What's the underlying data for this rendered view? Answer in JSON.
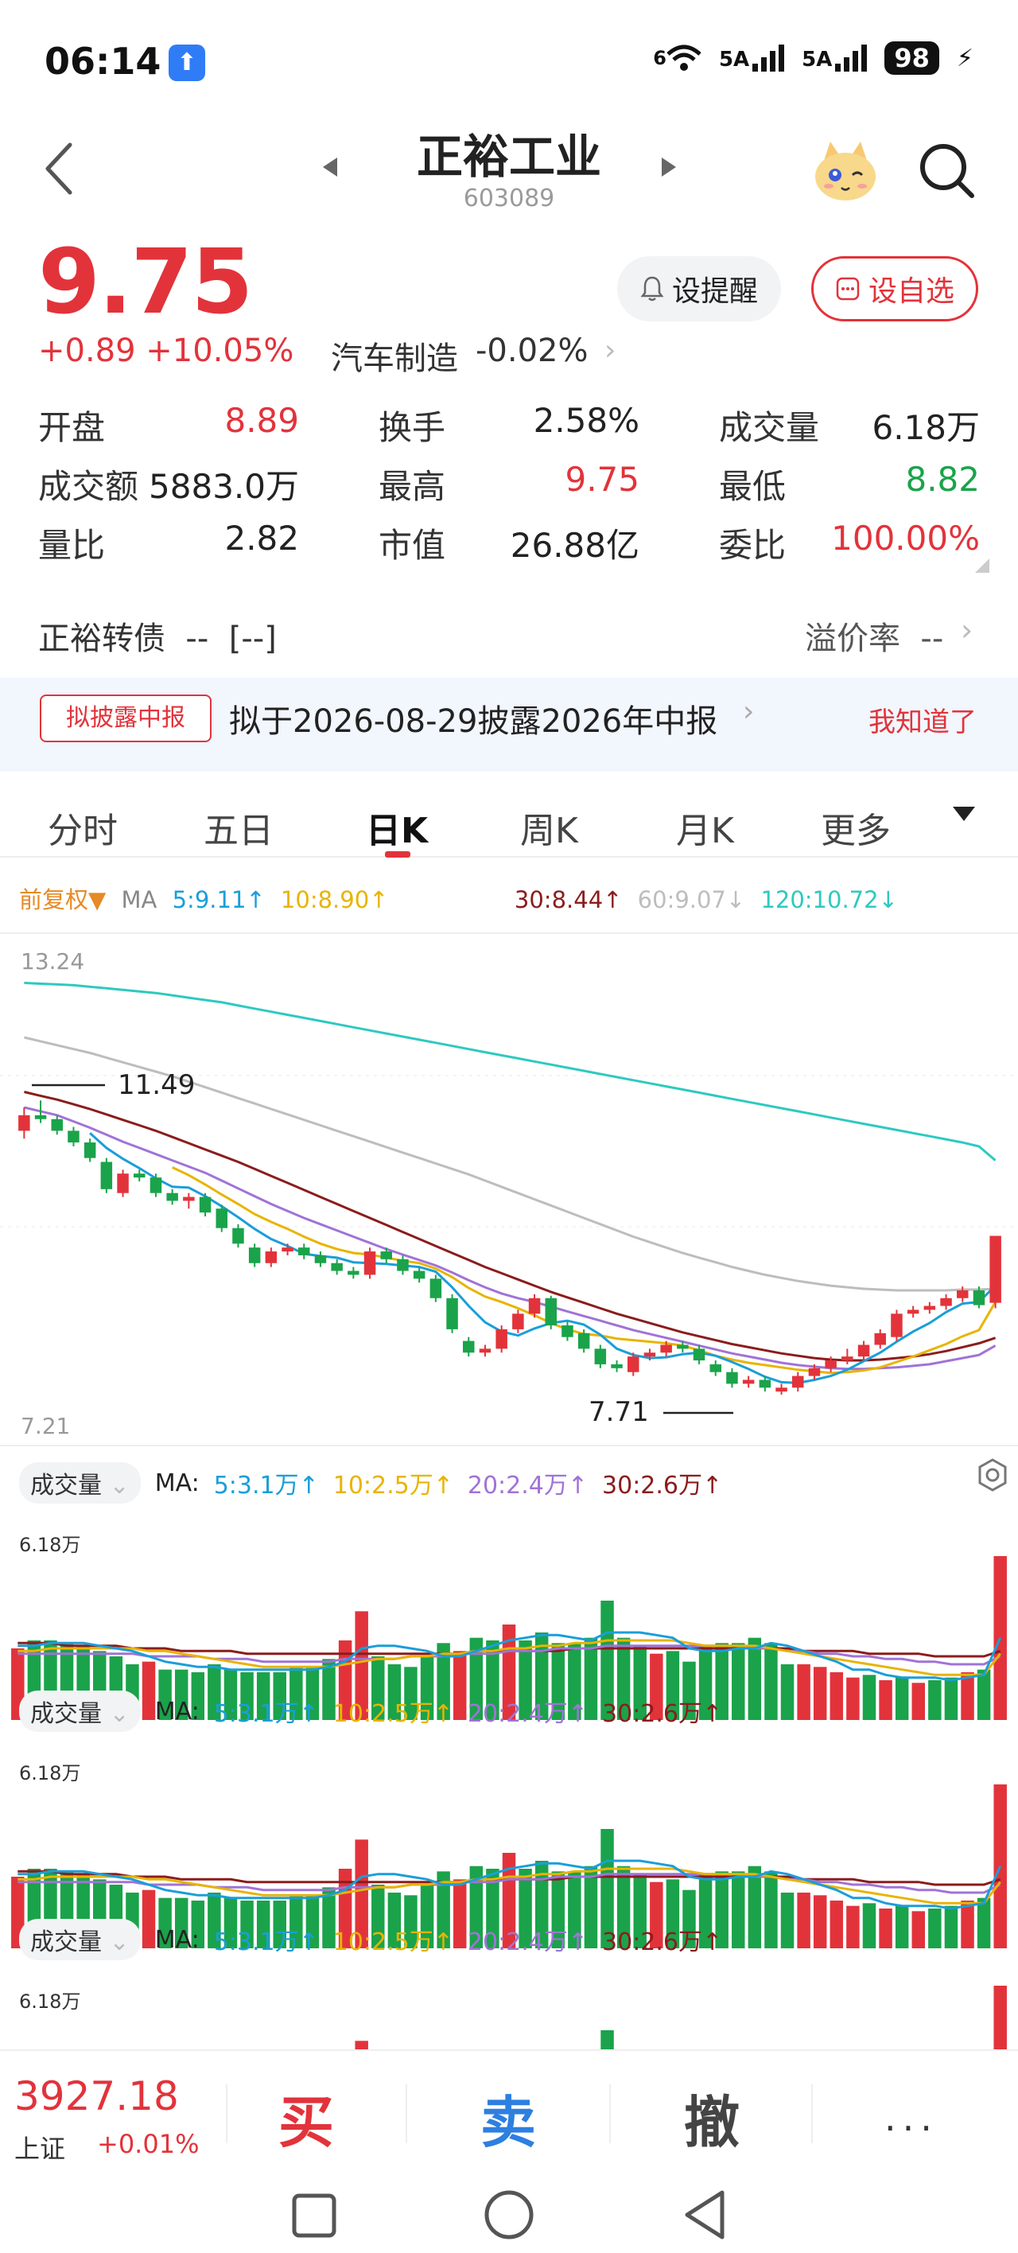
{
  "status": {
    "time": "06:14",
    "net1": "6",
    "net2": "5A",
    "net3": "5A",
    "battery": "98"
  },
  "header": {
    "name": "正裕工业",
    "code": "603089"
  },
  "quote": {
    "price": "9.75",
    "change": "+0.89 +10.05%",
    "sector": "汽车制造",
    "sector_change": "-0.02%",
    "alert_label": "设提醒",
    "fav_label": "设自选"
  },
  "stats": [
    [
      {
        "label": "开盘",
        "value": "8.89",
        "color": "red"
      },
      {
        "label": "换手",
        "value": "2.58%",
        "color": "dark"
      },
      {
        "label": "成交量",
        "value": "6.18万",
        "color": "dark"
      }
    ],
    [
      {
        "label": "成交额",
        "value": "5883.0万",
        "color": "dark"
      },
      {
        "label": "最高",
        "value": "9.75",
        "color": "red"
      },
      {
        "label": "最低",
        "value": "8.82",
        "color": "green"
      }
    ],
    [
      {
        "label": "量比",
        "value": "2.82",
        "color": "dark"
      },
      {
        "label": "市值",
        "value": "26.88亿",
        "color": "dark"
      },
      {
        "label": "委比",
        "value": "100.00%",
        "color": "red"
      }
    ]
  ],
  "bond": {
    "label": "正裕转债  --  [--]",
    "premium": "溢价率  --"
  },
  "notice": {
    "tag": "拟披露中报",
    "text": "拟于2026-08-29披露2026年中报",
    "ok": "我知道了"
  },
  "tabs": [
    "分时",
    "五日",
    "日K",
    "周K",
    "月K",
    "更多"
  ],
  "active_tab": 2,
  "ma_bar": {
    "adjust": "前复权▼",
    "ma": "MA",
    "ma5": "5:9.11↑",
    "ma10": "10:8.90↑",
    "ma30": "30:8.44↑",
    "ma60": "60:9.07↓",
    "ma120": "120:10.72↓"
  },
  "kline": {
    "ymax_label": "13.24",
    "ymin_label": "7.21",
    "high_marker": "11.49",
    "low_marker": "7.71"
  },
  "volume_panel": {
    "label": "成交量",
    "ma": "MA:",
    "ma5": "5:3.1万↑",
    "ma10": "10:2.5万↑",
    "ma20": "20:2.4万↑",
    "ma30": "30:2.6万↑",
    "max_label": "6.18万"
  },
  "bottom": {
    "index_value": "3927.18",
    "index_name": "上证",
    "index_change": "+0.01%",
    "buy": "买",
    "sell": "卖",
    "cancel": "撤",
    "more": "···"
  },
  "colors": {
    "up": "#e2333b",
    "down": "#1aa34a",
    "ma5": "#1a9ed9",
    "ma10": "#e8b400",
    "ma20": "#a073d6",
    "ma30": "#8b1c1c",
    "ma60": "#bdbdbd",
    "ma120": "#2ec9c0"
  },
  "chart_data": [
    {
      "type": "candlestick",
      "title": "",
      "ylim": [
        7.21,
        13.24
      ],
      "x": [
        1,
        2,
        3,
        4,
        5,
        6,
        7,
        8,
        9,
        10,
        11,
        12,
        13,
        14,
        15,
        16,
        17,
        18,
        19,
        20,
        21,
        22,
        23,
        24,
        25,
        26,
        27,
        28,
        29,
        30,
        31,
        32,
        33,
        34,
        35,
        36,
        37,
        38,
        39,
        40,
        41,
        42,
        43,
        44,
        45,
        46,
        47,
        48,
        49,
        50,
        51,
        52,
        53,
        54,
        55,
        56,
        57,
        58,
        59,
        60
      ],
      "open": [
        11.1,
        11.3,
        11.25,
        11.1,
        10.95,
        10.7,
        10.3,
        10.55,
        10.5,
        10.3,
        10.2,
        10.25,
        10.1,
        9.85,
        9.6,
        9.4,
        9.55,
        9.6,
        9.5,
        9.4,
        9.3,
        9.25,
        9.55,
        9.45,
        9.3,
        9.2,
        8.95,
        8.4,
        8.25,
        8.3,
        8.55,
        8.75,
        8.95,
        8.6,
        8.5,
        8.3,
        8.1,
        8.0,
        8.2,
        8.25,
        8.35,
        8.3,
        8.1,
        8.0,
        7.85,
        7.9,
        7.75,
        7.8,
        7.95,
        8.05,
        8.15,
        8.2,
        8.35,
        8.45,
        8.75,
        8.8,
        8.85,
        8.95,
        9.05,
        8.89
      ],
      "close": [
        11.3,
        11.25,
        11.1,
        10.95,
        10.75,
        10.35,
        10.55,
        10.5,
        10.3,
        10.2,
        10.25,
        10.05,
        9.85,
        9.65,
        9.4,
        9.55,
        9.6,
        9.5,
        9.4,
        9.3,
        9.25,
        9.55,
        9.45,
        9.3,
        9.2,
        8.95,
        8.55,
        8.25,
        8.3,
        8.55,
        8.75,
        8.95,
        8.6,
        8.45,
        8.3,
        8.1,
        8.05,
        8.2,
        8.25,
        8.35,
        8.3,
        8.15,
        8.0,
        7.85,
        7.9,
        7.8,
        7.8,
        7.95,
        8.05,
        8.15,
        8.2,
        8.35,
        8.5,
        8.75,
        8.8,
        8.85,
        8.95,
        9.05,
        8.86,
        9.75
      ],
      "high": [
        11.4,
        11.49,
        11.3,
        11.15,
        11.0,
        10.75,
        10.6,
        10.6,
        10.55,
        10.35,
        10.3,
        10.3,
        10.15,
        9.9,
        9.65,
        9.6,
        9.65,
        9.65,
        9.55,
        9.45,
        9.35,
        9.6,
        9.6,
        9.5,
        9.35,
        9.25,
        9.0,
        8.45,
        8.35,
        8.6,
        8.8,
        9.0,
        8.98,
        8.65,
        8.55,
        8.35,
        8.15,
        8.25,
        8.3,
        8.4,
        8.4,
        8.35,
        8.15,
        8.05,
        7.95,
        7.95,
        7.85,
        8.0,
        8.1,
        8.2,
        8.3,
        8.4,
        8.55,
        8.8,
        8.85,
        8.9,
        9.0,
        9.1,
        9.1,
        9.75
      ],
      "low": [
        11.0,
        11.2,
        11.05,
        10.9,
        10.7,
        10.3,
        10.25,
        10.45,
        10.25,
        10.15,
        10.1,
        10.0,
        9.8,
        9.6,
        9.35,
        9.35,
        9.5,
        9.45,
        9.35,
        9.25,
        9.2,
        9.2,
        9.4,
        9.25,
        9.15,
        8.9,
        8.5,
        8.2,
        8.2,
        8.25,
        8.5,
        8.7,
        8.55,
        8.4,
        8.25,
        8.05,
        8.0,
        7.95,
        8.15,
        8.2,
        8.25,
        8.1,
        7.95,
        7.8,
        7.8,
        7.75,
        7.71,
        7.75,
        7.9,
        8.0,
        8.1,
        8.15,
        8.3,
        8.4,
        8.7,
        8.75,
        8.8,
        8.9,
        8.82,
        8.82
      ],
      "ma5": [
        null,
        null,
        null,
        null,
        11.07,
        10.88,
        10.74,
        10.62,
        10.49,
        10.38,
        10.37,
        10.26,
        10.13,
        9.99,
        9.84,
        9.71,
        9.62,
        9.52,
        9.49,
        9.47,
        9.41,
        9.4,
        9.39,
        9.37,
        9.35,
        9.29,
        9.09,
        8.85,
        8.64,
        8.52,
        8.47,
        8.56,
        8.63,
        8.66,
        8.61,
        8.48,
        8.3,
        8.22,
        8.18,
        8.19,
        8.23,
        8.25,
        8.21,
        8.13,
        8.04,
        7.94,
        7.87,
        7.86,
        7.9,
        7.95,
        8.03,
        8.14,
        8.25,
        8.39,
        8.52,
        8.63,
        8.77,
        8.88,
        8.9,
        9.11
      ],
      "ma10": [
        null,
        null,
        null,
        null,
        null,
        null,
        null,
        null,
        null,
        10.63,
        10.53,
        10.41,
        10.28,
        10.16,
        10.03,
        9.93,
        9.84,
        9.74,
        9.65,
        9.58,
        9.53,
        9.51,
        9.47,
        9.43,
        9.4,
        9.33,
        9.22,
        9.08,
        8.97,
        8.9,
        8.82,
        8.73,
        8.63,
        8.55,
        8.49,
        8.47,
        8.43,
        8.41,
        8.39,
        8.37,
        8.34,
        8.28,
        8.21,
        8.16,
        8.12,
        8.09,
        8.06,
        8.03,
        8.01,
        7.99,
        8.0,
        8.02,
        8.06,
        8.13,
        8.2,
        8.28,
        8.36,
        8.46,
        8.54,
        8.9
      ],
      "ma20": [
        11.4,
        11.35,
        11.3,
        11.22,
        11.14,
        11.05,
        10.96,
        10.88,
        10.8,
        10.72,
        10.64,
        10.56,
        10.46,
        10.36,
        10.26,
        10.16,
        10.07,
        9.98,
        9.9,
        9.82,
        9.74,
        9.66,
        9.58,
        9.51,
        9.44,
        9.37,
        9.28,
        9.18,
        9.09,
        9.01,
        8.95,
        8.9,
        8.84,
        8.78,
        8.72,
        8.66,
        8.6,
        8.54,
        8.49,
        8.44,
        8.39,
        8.34,
        8.29,
        8.24,
        8.2,
        8.16,
        8.12,
        8.09,
        8.07,
        8.05,
        8.04,
        8.04,
        8.05,
        8.06,
        8.08,
        8.1,
        8.14,
        8.18,
        8.22,
        8.34
      ],
      "ma30": [
        11.6,
        11.55,
        11.5,
        11.44,
        11.38,
        11.31,
        11.24,
        11.17,
        11.1,
        11.02,
        10.94,
        10.86,
        10.78,
        10.7,
        10.61,
        10.52,
        10.43,
        10.34,
        10.25,
        10.16,
        10.07,
        9.98,
        9.89,
        9.8,
        9.71,
        9.62,
        9.53,
        9.44,
        9.35,
        9.27,
        9.19,
        9.11,
        9.03,
        8.96,
        8.89,
        8.82,
        8.75,
        8.69,
        8.63,
        8.57,
        8.51,
        8.46,
        8.41,
        8.36,
        8.32,
        8.28,
        8.24,
        8.21,
        8.18,
        8.16,
        8.15,
        8.15,
        8.16,
        8.18,
        8.2,
        8.23,
        8.27,
        8.32,
        8.37,
        8.44
      ],
      "ma60": [
        12.3,
        12.25,
        12.2,
        12.15,
        12.1,
        12.04,
        11.98,
        11.92,
        11.86,
        11.8,
        11.73,
        11.66,
        11.59,
        11.52,
        11.45,
        11.38,
        11.31,
        11.24,
        11.17,
        11.1,
        11.03,
        10.96,
        10.89,
        10.82,
        10.75,
        10.68,
        10.61,
        10.54,
        10.46,
        10.38,
        10.3,
        10.22,
        10.14,
        10.06,
        9.98,
        9.9,
        9.82,
        9.74,
        9.67,
        9.6,
        9.53,
        9.47,
        9.41,
        9.35,
        9.3,
        9.25,
        9.21,
        9.17,
        9.14,
        9.11,
        9.09,
        9.07,
        9.06,
        9.05,
        9.05,
        9.05,
        9.05,
        9.06,
        9.06,
        9.07
      ],
      "ma120": [
        13.0,
        12.99,
        12.98,
        12.97,
        12.95,
        12.93,
        12.91,
        12.89,
        12.87,
        12.84,
        12.81,
        12.78,
        12.75,
        12.71,
        12.67,
        12.63,
        12.59,
        12.55,
        12.51,
        12.47,
        12.43,
        12.39,
        12.35,
        12.31,
        12.27,
        12.23,
        12.19,
        12.15,
        12.11,
        12.07,
        12.03,
        11.99,
        11.95,
        11.91,
        11.87,
        11.83,
        11.79,
        11.75,
        11.71,
        11.67,
        11.63,
        11.59,
        11.55,
        11.51,
        11.47,
        11.43,
        11.39,
        11.35,
        11.31,
        11.27,
        11.23,
        11.19,
        11.15,
        11.11,
        11.07,
        11.03,
        10.99,
        10.95,
        10.9,
        10.72
      ]
    },
    {
      "type": "bar",
      "title": "成交量",
      "ylim": [
        0,
        6.18
      ],
      "values": [
        2.7,
        3.0,
        3.0,
        2.9,
        2.8,
        2.6,
        2.4,
        2.1,
        2.2,
        1.9,
        1.9,
        1.8,
        2.1,
        1.9,
        1.8,
        1.8,
        1.8,
        2.0,
        2.0,
        2.3,
        3.0,
        4.1,
        2.4,
        2.1,
        2.0,
        2.4,
        2.9,
        2.6,
        3.1,
        3.0,
        3.6,
        3.0,
        3.3,
        2.9,
        2.9,
        3.1,
        4.5,
        3.1,
        2.8,
        2.5,
        2.6,
        2.2,
        2.8,
        2.9,
        2.9,
        3.1,
        2.9,
        2.1,
        2.1,
        2.0,
        1.8,
        1.6,
        1.7,
        1.5,
        1.6,
        1.4,
        1.5,
        1.6,
        1.8,
        1.9,
        6.18
      ],
      "colors_up": [
        1,
        0,
        0,
        0,
        0,
        0,
        0,
        0,
        1,
        0,
        0,
        0,
        0,
        0,
        0,
        0,
        0,
        0,
        0,
        0,
        1,
        1,
        0,
        0,
        0,
        0,
        0,
        1,
        0,
        0,
        1,
        0,
        0,
        0,
        0,
        0,
        0,
        0,
        0,
        1,
        0,
        0,
        0,
        0,
        0,
        0,
        0,
        0,
        1,
        1,
        1,
        1,
        0,
        1,
        0,
        1,
        0,
        0,
        1,
        0,
        1
      ],
      "ma5": [
        2.8,
        2.8,
        2.9,
        2.9,
        2.9,
        2.8,
        2.7,
        2.6,
        2.4,
        2.2,
        2.1,
        2.0,
        2.0,
        1.9,
        1.9,
        1.9,
        1.9,
        1.9,
        1.9,
        2.0,
        2.2,
        2.7,
        2.8,
        2.8,
        2.7,
        2.6,
        2.4,
        2.4,
        2.6,
        2.8,
        3.0,
        3.1,
        3.2,
        3.2,
        3.1,
        3.0,
        3.3,
        3.3,
        3.3,
        3.2,
        3.1,
        2.7,
        2.6,
        2.6,
        2.7,
        2.7,
        2.9,
        2.8,
        2.6,
        2.4,
        2.2,
        1.9,
        1.9,
        1.7,
        1.6,
        1.6,
        1.6,
        1.5,
        1.6,
        1.7,
        3.1
      ],
      "ma10": [
        2.6,
        2.6,
        2.7,
        2.7,
        2.7,
        2.7,
        2.7,
        2.7,
        2.6,
        2.6,
        2.5,
        2.4,
        2.3,
        2.2,
        2.1,
        2.0,
        2.0,
        2.0,
        2.0,
        2.0,
        2.1,
        2.2,
        2.3,
        2.3,
        2.4,
        2.4,
        2.5,
        2.5,
        2.6,
        2.6,
        2.7,
        2.7,
        2.8,
        2.8,
        2.9,
        2.9,
        3.0,
        3.0,
        3.0,
        3.0,
        3.0,
        2.9,
        2.8,
        2.8,
        2.8,
        2.8,
        2.7,
        2.6,
        2.5,
        2.4,
        2.3,
        2.2,
        2.1,
        2.0,
        1.9,
        1.8,
        1.7,
        1.7,
        1.7,
        1.7,
        2.5
      ],
      "ma20": [
        2.5,
        2.5,
        2.5,
        2.5,
        2.5,
        2.5,
        2.5,
        2.5,
        2.4,
        2.4,
        2.4,
        2.4,
        2.3,
        2.3,
        2.3,
        2.2,
        2.2,
        2.2,
        2.2,
        2.2,
        2.3,
        2.3,
        2.3,
        2.3,
        2.4,
        2.4,
        2.4,
        2.5,
        2.5,
        2.5,
        2.6,
        2.6,
        2.6,
        2.7,
        2.7,
        2.7,
        2.8,
        2.8,
        2.8,
        2.8,
        2.8,
        2.8,
        2.8,
        2.8,
        2.8,
        2.7,
        2.7,
        2.6,
        2.6,
        2.5,
        2.5,
        2.4,
        2.4,
        2.3,
        2.3,
        2.2,
        2.2,
        2.1,
        2.1,
        2.1,
        2.4
      ],
      "ma30": [
        2.9,
        2.9,
        2.9,
        2.8,
        2.8,
        2.8,
        2.8,
        2.7,
        2.7,
        2.7,
        2.6,
        2.6,
        2.6,
        2.6,
        2.5,
        2.5,
        2.5,
        2.5,
        2.5,
        2.5,
        2.5,
        2.5,
        2.5,
        2.5,
        2.5,
        2.5,
        2.5,
        2.5,
        2.6,
        2.6,
        2.6,
        2.6,
        2.6,
        2.6,
        2.7,
        2.7,
        2.7,
        2.7,
        2.7,
        2.7,
        2.7,
        2.7,
        2.7,
        2.7,
        2.7,
        2.7,
        2.7,
        2.7,
        2.6,
        2.6,
        2.6,
        2.6,
        2.5,
        2.5,
        2.5,
        2.5,
        2.4,
        2.4,
        2.4,
        2.4,
        2.6
      ]
    }
  ]
}
